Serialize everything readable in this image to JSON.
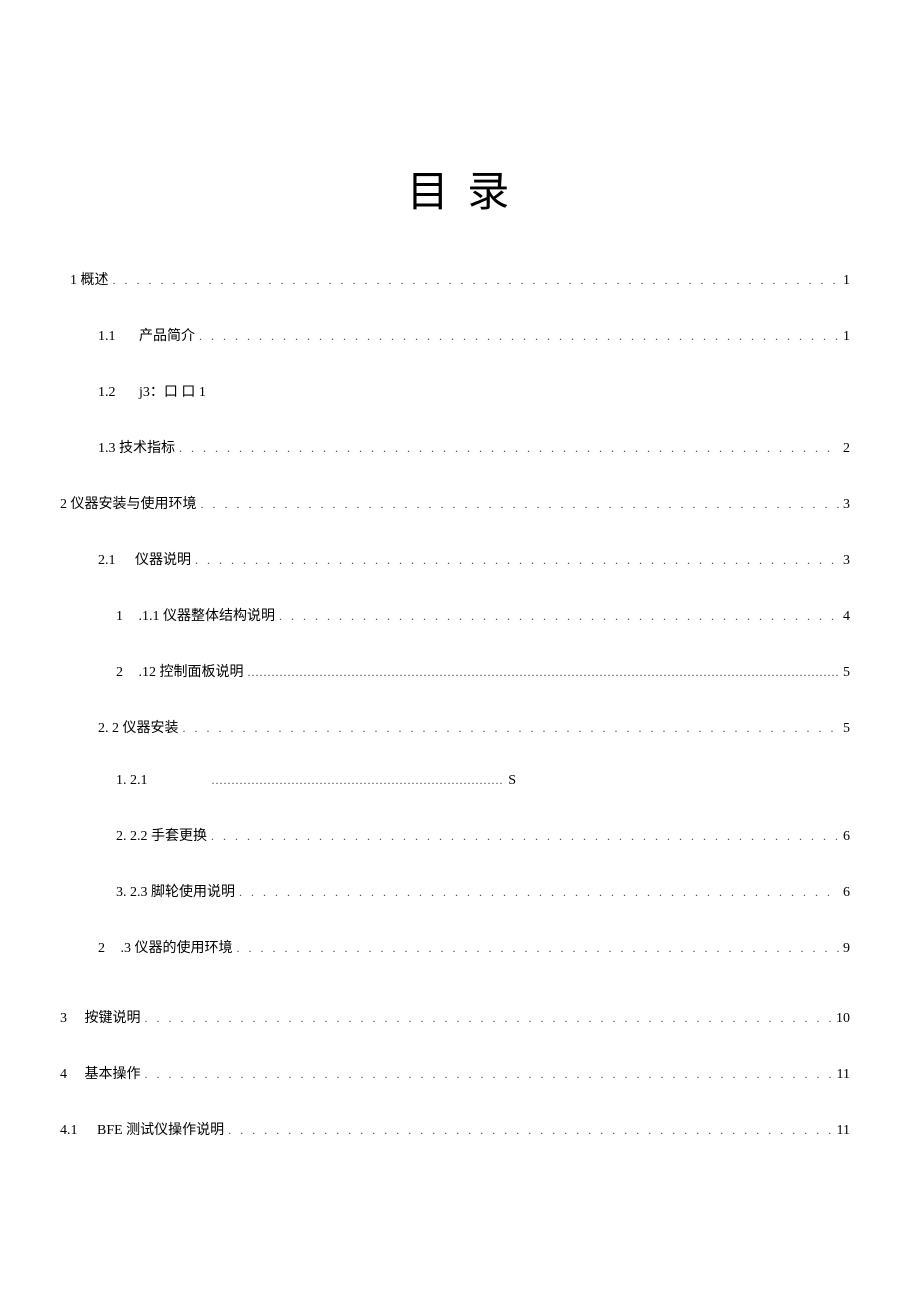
{
  "title": "目 录",
  "toc": [
    {
      "indent": 0,
      "label": "1 概述",
      "page": "1"
    },
    {
      "indent": 1,
      "label_num": "1.1",
      "label_text": "产品简介",
      "page": "1"
    },
    {
      "indent": 1,
      "label_num": "1.2",
      "label_text": "j3：口 口 1",
      "page": "",
      "nodots": true
    },
    {
      "indent": 1,
      "label": "1.3 技术指标",
      "page": "2"
    },
    {
      "indent": 0,
      "label": "2 仪器安装与使用环境",
      "page": "3",
      "neg": true
    },
    {
      "indent": 1,
      "label_num": "2.1",
      "label_text": "仪器说明",
      "page": "3"
    },
    {
      "indent": 2,
      "label_num": "1",
      "label_text": ".1.1 仪器整体结构说明",
      "page": "4"
    },
    {
      "indent": 2,
      "label_num": "2",
      "label_text": ".12 控制面板说明",
      "page": "5",
      "dots2": true
    },
    {
      "indent": 1,
      "label": "2.  2 仪器安装",
      "page": "5"
    },
    {
      "indent": 3,
      "label": "1.  2.1",
      "page": "S",
      "special121": true
    },
    {
      "indent": 3,
      "label": "2.  2.2 手套更换",
      "page": "6"
    },
    {
      "indent": 3,
      "label": "3.  2.3 脚轮使用说明",
      "page": "6"
    },
    {
      "indent": 1,
      "label_num": "2",
      "label_text": ".3 仪器的使用环境",
      "page": "9"
    },
    {
      "indent": 0,
      "label_num": "3",
      "label_text": "按键说明",
      "page": "10",
      "neg": true
    },
    {
      "indent": 0,
      "label_num": "4",
      "label_text": "基本操作",
      "page": "11",
      "neg": true
    },
    {
      "indent": 0,
      "label_num": "4.1",
      "label_text": "BFE 测试仪操作说明",
      "page": "11",
      "neg": true
    }
  ]
}
